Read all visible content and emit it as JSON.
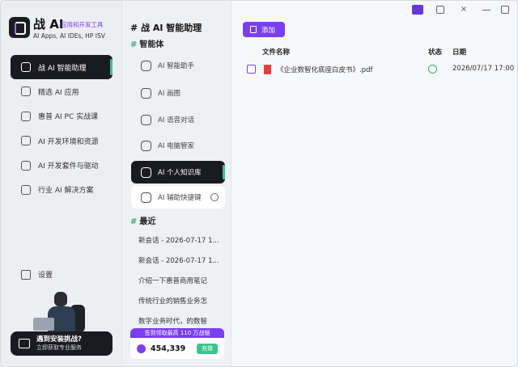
{
  "app": {
    "title": "战 AI",
    "tag": "应用和开发工具",
    "subtitle": "AI Apps, AI IDEs, HP ISV"
  },
  "sidebar": {
    "items": [
      {
        "label": "战 AI 智能助理",
        "icon": "robot-icon",
        "active": true
      },
      {
        "label": "精选 AI 应用",
        "icon": "terminal-icon"
      },
      {
        "label": "惠普 AI PC 实战课",
        "icon": "graduation-cap-icon"
      },
      {
        "label": "AI 开发环境和资源",
        "icon": "funnel-icon"
      },
      {
        "label": "AI 开发套件与驱动",
        "icon": "code-icon"
      },
      {
        "label": "行业 AI 解决方案",
        "icon": "isv-icon"
      }
    ],
    "settings_label": "设置",
    "help": {
      "title": "遇到安装挑战?",
      "subtitle": "立即获取专业服务"
    }
  },
  "middle": {
    "title": "# 战 AI 智能助理",
    "agents_section": "智能体",
    "agents": [
      {
        "label": "AI 智能助手",
        "icon": "chat-sparkle-icon"
      },
      {
        "label": "AI 画图",
        "icon": "image-icon"
      },
      {
        "label": "AI 语音对话",
        "icon": "voice-wave-icon"
      },
      {
        "label": "AI 电脑管家",
        "icon": "person-settings-icon"
      },
      {
        "label": "AI 个人知识库",
        "icon": "knowledge-book-icon",
        "active": true
      },
      {
        "label": "AI 辅助快捷键",
        "icon": "hand-pointer-icon",
        "settings_icon": "gear-icon"
      }
    ],
    "recent_section": "最近",
    "recent": [
      "新会话 - 2026-07-17 1...",
      "新会话 - 2026-07-17 1...",
      "介绍一下惠普商用笔记",
      "传统行业的销售业务怎",
      "数字业务时代，的数智"
    ],
    "promo": "签到领取最高 110 万战锯",
    "points": "454,339",
    "recharge_label": "充值"
  },
  "window_controls": [
    "pin-icon",
    "download-icon",
    "×",
    "minimize-icon",
    "expand-icon",
    "×"
  ],
  "main": {
    "add_label": "添加",
    "columns": {
      "name": "文件名称",
      "status": "状态",
      "date": "日期"
    },
    "rows": [
      {
        "name": "《企业数智化底座白皮书》.pdf",
        "status": "ok",
        "date": "2026/07/17 17:00"
      }
    ]
  },
  "colors": {
    "accent": "#7b3ff0",
    "dark": "#1a1b22",
    "green": "#3ec48b",
    "pdf": "#e0423a"
  }
}
